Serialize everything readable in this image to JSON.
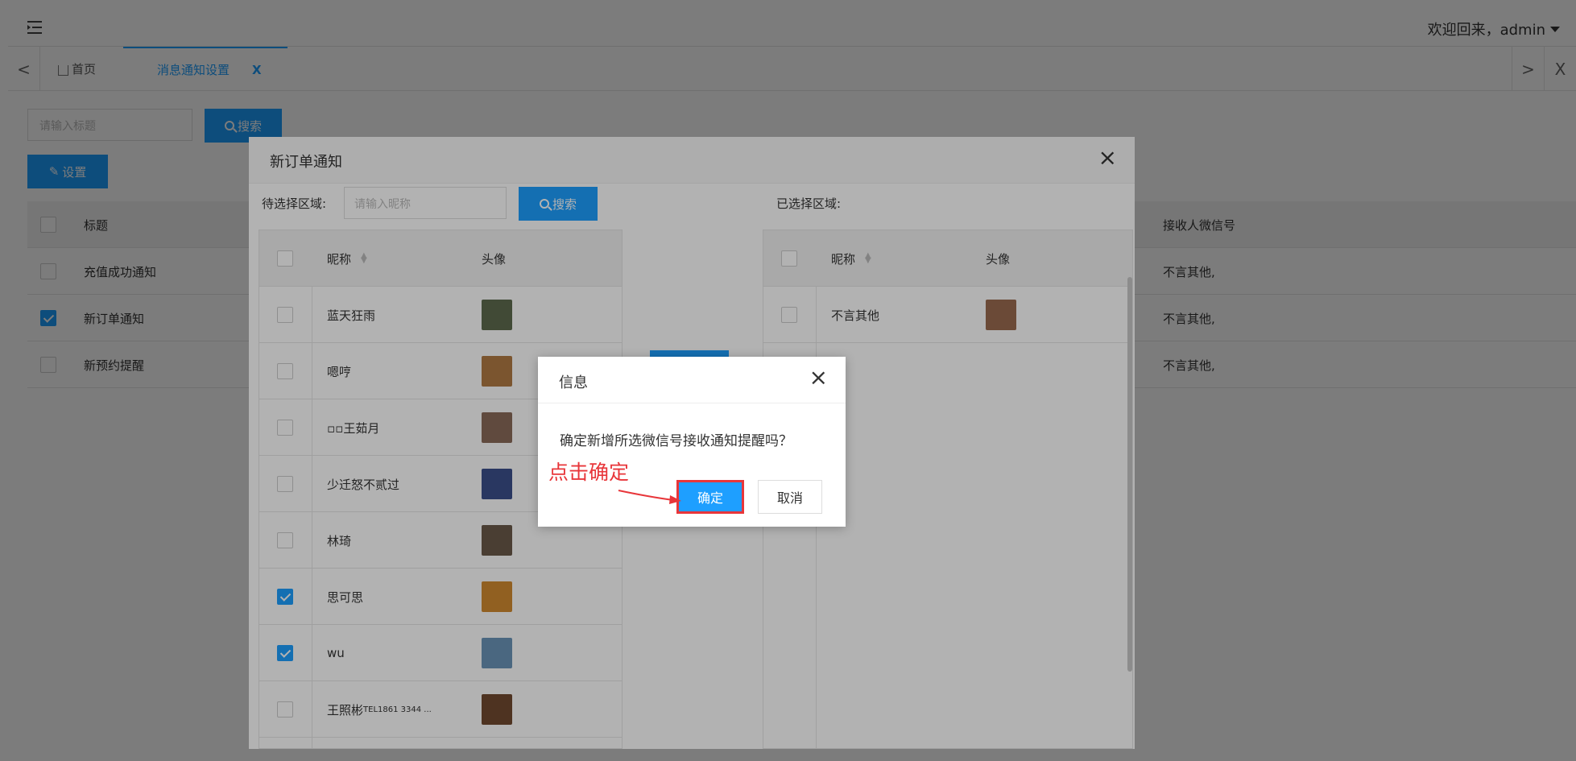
{
  "header": {
    "welcome": "欢迎回来，admin"
  },
  "tabs": {
    "home": "首页",
    "active": "消息通知设置",
    "active_close": "X",
    "prev": "<",
    "next": ">",
    "close_all": "X"
  },
  "base": {
    "search_placeholder": "请输入标题",
    "search_label": "搜索",
    "set_label": "设置",
    "columns": {
      "title": "标题",
      "wechat": "接收人微信号"
    },
    "rows": [
      {
        "title": "充值成功通知",
        "wechat": "不言其他,",
        "checked": false
      },
      {
        "title": "新订单通知",
        "wechat": "不言其他,",
        "checked": true
      },
      {
        "title": "新预约提醒",
        "wechat": "不言其他,",
        "checked": false
      }
    ]
  },
  "modal": {
    "title": "新订单通知",
    "close": "×",
    "pending_label": "待选择区域:",
    "search_placeholder": "请输入昵称",
    "search_label": "搜索",
    "selected_label": "已选择区域:",
    "col_name": "昵称",
    "col_avatar": "头像",
    "left_rows": [
      {
        "name": "蓝天狂雨",
        "checked": false,
        "color": "#5d6b4e"
      },
      {
        "name": "嗯哼",
        "checked": false,
        "color": "#b07a44"
      },
      {
        "name": "▫▫王茹月",
        "checked": false,
        "color": "#8a6a5a"
      },
      {
        "name": "少迁怒不贰过",
        "checked": false,
        "color": "#3b4f8c"
      },
      {
        "name": "林琦",
        "checked": false,
        "color": "#6b5a4a"
      },
      {
        "name": "思可思",
        "checked": true,
        "color": "#d08a30"
      },
      {
        "name": "wu",
        "checked": true,
        "color": "#6a94b8"
      },
      {
        "name": "王照彬",
        "tel": "TEL1861 3344 ...",
        "checked": false,
        "color": "#704a30"
      }
    ],
    "right_rows": [
      {
        "name": "不言其他",
        "checked": false,
        "color": "#9a6a50"
      }
    ]
  },
  "dialog": {
    "title": "信息",
    "close": "×",
    "message": "确定新增所选微信号接收通知提醒吗？",
    "ok": "确定",
    "cancel": "取消"
  },
  "annotation": {
    "text": "点击确定"
  },
  "colors": {
    "primary": "#1E9FFF",
    "annotation": "#e8363a"
  }
}
